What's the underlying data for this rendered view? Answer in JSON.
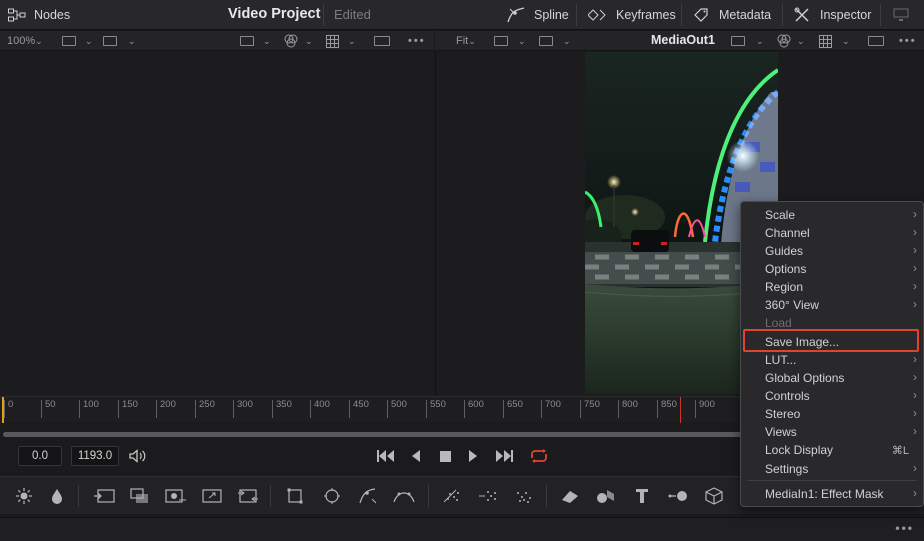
{
  "topbar": {
    "nodes_label": "Nodes",
    "project_title": "Video Project",
    "project_status": "Edited",
    "spline_label": "Spline",
    "keyframes_label": "Keyframes",
    "metadata_label": "Metadata",
    "inspector_label": "Inspector"
  },
  "left_viewer": {
    "zoom": "100%"
  },
  "right_viewer": {
    "zoom": "Fit",
    "title": "MediaOut1"
  },
  "ruler": {
    "ticks": [
      "0",
      "50",
      "100",
      "150",
      "200",
      "250",
      "300",
      "350",
      "400",
      "450",
      "500",
      "550",
      "600",
      "650",
      "700",
      "750",
      "800",
      "850",
      "900"
    ]
  },
  "transport": {
    "current_time": "0.0",
    "end_time": "1193.0"
  },
  "context_menu": {
    "items": [
      {
        "label": "Scale",
        "submenu": true
      },
      {
        "label": "Channel",
        "submenu": true
      },
      {
        "label": "Guides",
        "submenu": true
      },
      {
        "label": "Options",
        "submenu": true
      },
      {
        "label": "Region",
        "submenu": true
      },
      {
        "label": "360° View",
        "submenu": true
      },
      {
        "label": "Load",
        "submenu": false
      },
      {
        "label": "Save Image...",
        "submenu": false
      },
      {
        "label": "LUT...",
        "submenu": true
      },
      {
        "label": "Global Options",
        "submenu": true
      },
      {
        "label": "Controls",
        "submenu": true
      },
      {
        "label": "Stereo",
        "submenu": true
      },
      {
        "label": "Views",
        "submenu": true
      },
      {
        "label": "Lock Display",
        "shortcut": "⌘L"
      },
      {
        "label": "Settings",
        "submenu": true
      },
      {
        "label": "MediaIn1: Effect Mask",
        "submenu": true
      }
    ],
    "highlight_color": "#e0442c"
  },
  "colors": {
    "accent_playhead": "#e0a21a",
    "loop_icon": "#e0442c"
  }
}
